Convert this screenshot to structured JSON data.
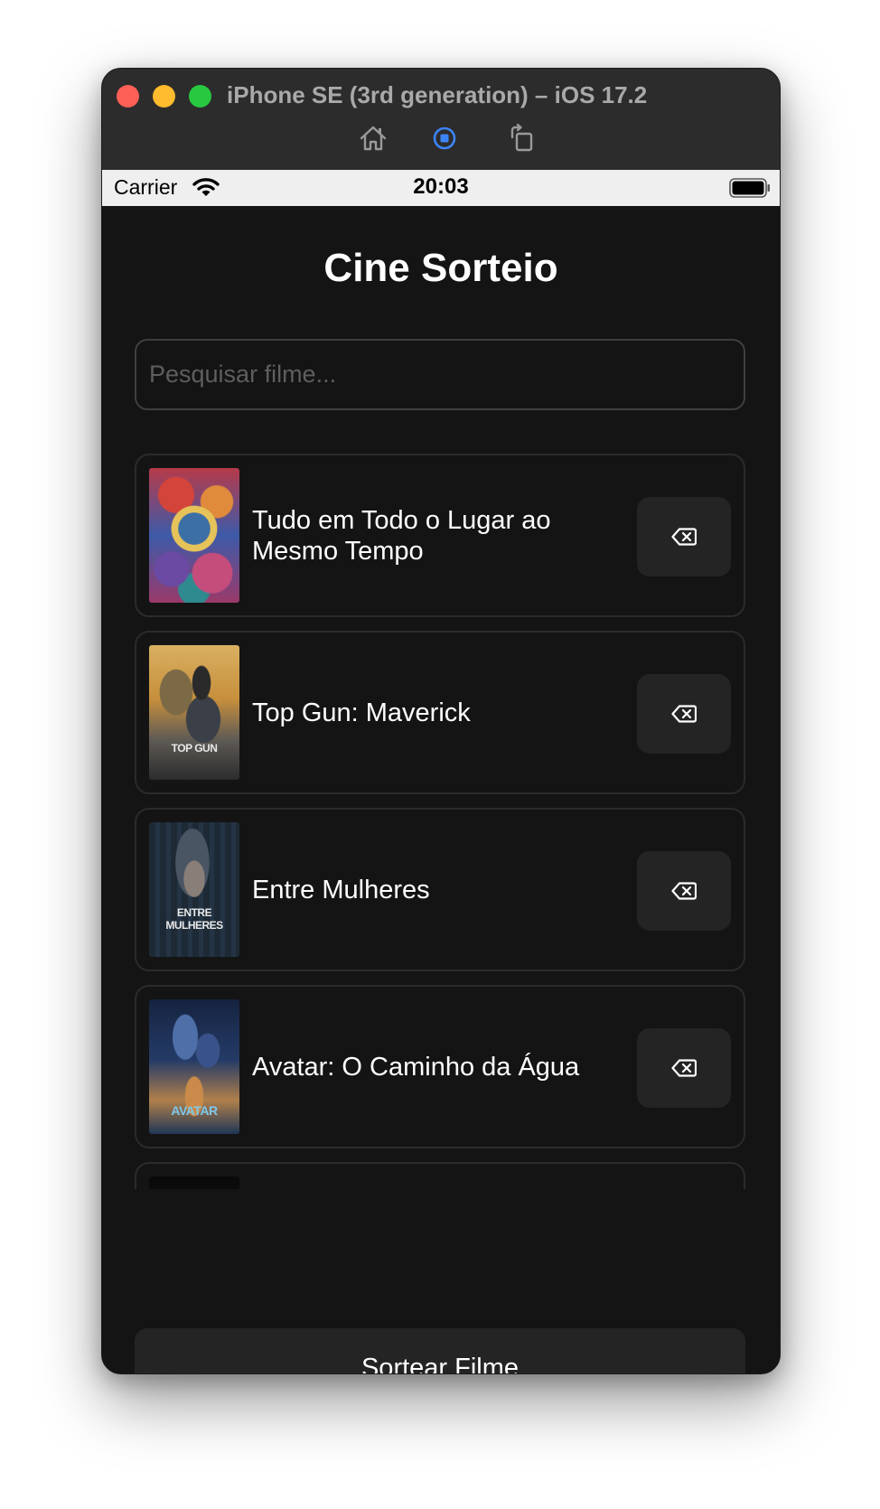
{
  "window": {
    "title": "iPhone SE (3rd generation) – iOS 17.2",
    "toolbar_icons": [
      "home-icon",
      "screenshot-icon",
      "rotate-icon"
    ]
  },
  "statusbar": {
    "carrier": "Carrier",
    "time": "20:03"
  },
  "app": {
    "title": "Cine Sorteio",
    "search": {
      "placeholder": "Pesquisar filme...",
      "value": ""
    },
    "movies": [
      {
        "title": "Tudo em Todo o Lugar ao Mesmo Tempo"
      },
      {
        "title": "Top Gun: Maverick",
        "poster_text": "TOP GUN"
      },
      {
        "title": "Entre Mulheres",
        "poster_text": "ENTRE MULHERES"
      },
      {
        "title": "Avatar: O Caminho da Água",
        "poster_text": "AVATAR"
      }
    ],
    "draw_button_label": "Sortear Filme"
  },
  "colors": {
    "background": "#141414",
    "card_border": "#2b2b2b",
    "button_bg": "#242424",
    "text": "#ffffff"
  }
}
